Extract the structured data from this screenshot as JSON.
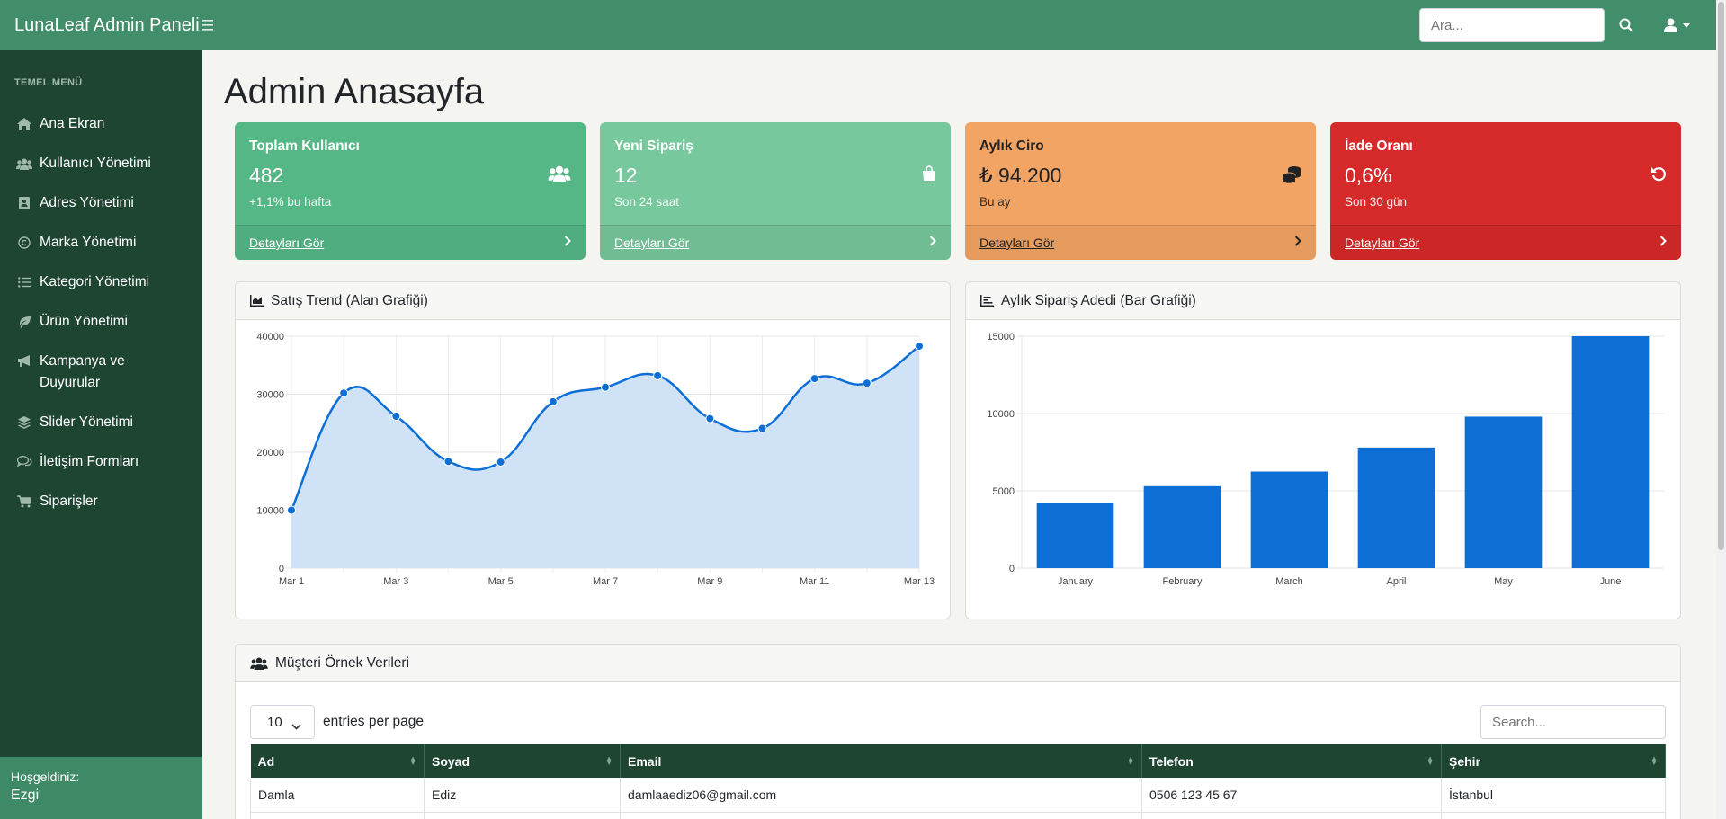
{
  "app": {
    "title": "LunaLeaf Admin Paneli"
  },
  "topbar": {
    "search_placeholder": "Ara..."
  },
  "sidebar": {
    "heading": "TEMEL MENÜ",
    "items": [
      {
        "label": "Ana Ekran",
        "icon": "home-icon"
      },
      {
        "label": "Kullanıcı Yönetimi",
        "icon": "users-icon"
      },
      {
        "label": "Adres Yönetimi",
        "icon": "address-book-icon"
      },
      {
        "label": "Marka Yönetimi",
        "icon": "copyright-icon"
      },
      {
        "label": "Kategori Yönetimi",
        "icon": "list-icon"
      },
      {
        "label": "Ürün Yönetimi",
        "icon": "leaf-icon"
      },
      {
        "label": "Kampanya ve Duyurular",
        "icon": "megaphone-icon"
      },
      {
        "label": "Slider Yönetimi",
        "icon": "layers-icon"
      },
      {
        "label": "İletişim Formları",
        "icon": "comments-icon"
      },
      {
        "label": "Siparişler",
        "icon": "cart-icon"
      }
    ],
    "footer": {
      "greeting": "Hoşgeldiniz:",
      "user": "Ezgi"
    }
  },
  "page": {
    "title": "Admin Anasayfa"
  },
  "stat_cards": [
    {
      "title": "Toplam Kullanıcı",
      "value": "482",
      "sub": "+1,1% bu hafta",
      "link": "Detayları Gör",
      "color": "#55b786",
      "icon": "users-icon"
    },
    {
      "title": "Yeni Sipariş",
      "value": "12",
      "sub": "Son 24 saat",
      "link": "Detayları Gör",
      "color": "#77c89c",
      "icon": "shopping-bag-icon"
    },
    {
      "title": "Aylık Ciro",
      "value": "₺ 94.200",
      "sub": "Bu ay",
      "link": "Detayları Gör",
      "color": "#f2a464",
      "icon": "coins-icon"
    },
    {
      "title": "İade Oranı",
      "value": "0,6%",
      "sub": "Son 30 gün",
      "link": "Detayları Gör",
      "color": "#d62a2a",
      "icon": "undo-icon"
    }
  ],
  "charts": {
    "area_title": "Satış Trend (Alan Grafiği)",
    "bar_title": "Aylık Sipariş Adedi (Bar Grafiği)"
  },
  "chart_data": [
    {
      "type": "area",
      "title": "Satış Trend (Alan Grafiği)",
      "x": [
        "Mar 1",
        "Mar 2",
        "Mar 3",
        "Mar 4",
        "Mar 5",
        "Mar 6",
        "Mar 7",
        "Mar 8",
        "Mar 9",
        "Mar 10",
        "Mar 11",
        "Mar 12",
        "Mar 13"
      ],
      "x_ticks": [
        "Mar 1",
        "Mar 3",
        "Mar 5",
        "Mar 7",
        "Mar 9",
        "Mar 11",
        "Mar 13"
      ],
      "values": [
        10000,
        30200,
        26200,
        18400,
        18300,
        28700,
        31200,
        33200,
        25800,
        24100,
        32700,
        31900,
        38300
      ],
      "ylim": [
        0,
        40000
      ],
      "y_ticks": [
        0,
        10000,
        20000,
        30000,
        40000
      ],
      "color": "#0d6fd6",
      "fill": "#cfe2f6",
      "grid": true
    },
    {
      "type": "bar",
      "title": "Aylık Sipariş Adedi (Bar Grafiği)",
      "categories": [
        "January",
        "February",
        "March",
        "April",
        "May",
        "June"
      ],
      "values": [
        4200,
        5300,
        6250,
        7800,
        9800,
        15000
      ],
      "ylim": [
        0,
        15000
      ],
      "y_ticks": [
        0,
        5000,
        10000,
        15000
      ],
      "color": "#0d6fd6",
      "grid": true
    }
  ],
  "customers": {
    "title": "Müşteri Örnek Verileri",
    "entries_value": "10",
    "entries_label": "entries per page",
    "search_placeholder": "Search...",
    "columns": [
      "Ad",
      "Soyad",
      "Email",
      "Telefon",
      "Şehir"
    ],
    "rows": [
      [
        "Damla",
        "Ediz",
        "damlaaediz06@gmail.com",
        "0506 123 45 67",
        "İstanbul"
      ],
      [
        "",
        "",
        "",
        "",
        ""
      ]
    ]
  }
}
